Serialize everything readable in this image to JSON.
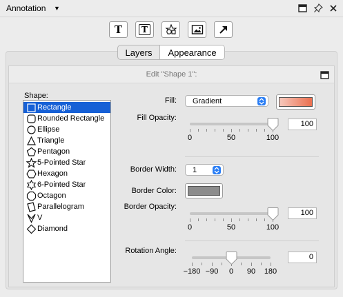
{
  "panel": {
    "title": "Annotation"
  },
  "tabs": {
    "layers": "Layers",
    "appearance": "Appearance"
  },
  "edit": {
    "title": "Edit \"Shape 1\":"
  },
  "shapes": {
    "label": "Shape:",
    "items": [
      {
        "label": "Rectangle",
        "icon": "rectangle-icon",
        "selected": true
      },
      {
        "label": "Rounded Rectangle",
        "icon": "rounded-rectangle-icon"
      },
      {
        "label": "Ellipse",
        "icon": "ellipse-icon"
      },
      {
        "label": "Triangle",
        "icon": "triangle-icon"
      },
      {
        "label": "Pentagon",
        "icon": "pentagon-icon"
      },
      {
        "label": "5-Pointed Star",
        "icon": "five-pointed-star-icon"
      },
      {
        "label": "Hexagon",
        "icon": "hexagon-icon"
      },
      {
        "label": "6-Pointed Star",
        "icon": "six-pointed-star-icon"
      },
      {
        "label": "Octagon",
        "icon": "octagon-icon"
      },
      {
        "label": "Parallelogram",
        "icon": "parallelogram-icon"
      },
      {
        "label": "V",
        "icon": "v-icon"
      },
      {
        "label": "Diamond",
        "icon": "diamond-icon"
      }
    ]
  },
  "fill": {
    "label": "Fill:",
    "value": "Gradient",
    "color_start": "#f6c8bc",
    "color_end": "#eb6f4f"
  },
  "fill_opacity": {
    "label": "Fill Opacity:",
    "value": "100",
    "ticks": [
      "0",
      "50",
      "100"
    ],
    "level": 1.0
  },
  "border_width": {
    "label": "Border Width:",
    "value": "1"
  },
  "border_color": {
    "label": "Border Color:",
    "color": "#8c8c8c"
  },
  "border_opacity": {
    "label": "Border Opacity:",
    "value": "100",
    "ticks": [
      "0",
      "50",
      "100"
    ],
    "level": 1.0
  },
  "rotation": {
    "label": "Rotation Angle:",
    "value": "0",
    "ticks": [
      "−180",
      "−90",
      "0",
      "90",
      "180"
    ],
    "level": 0.5
  },
  "colors": {
    "selection": "#1660d6",
    "accent": "#2a7ef5"
  }
}
